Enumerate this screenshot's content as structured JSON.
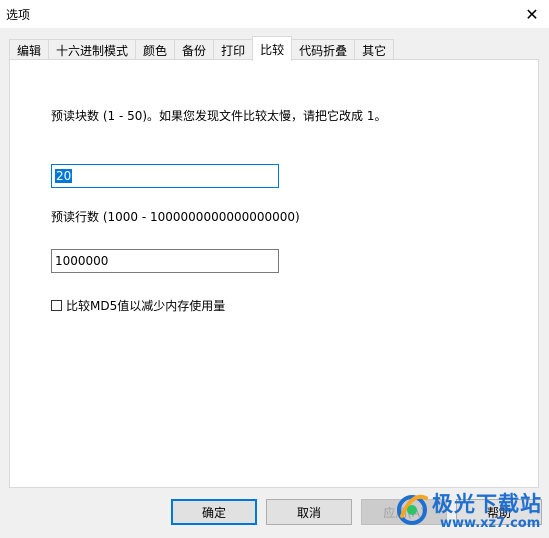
{
  "window": {
    "title": "选项"
  },
  "tabs": [
    {
      "label": "编辑"
    },
    {
      "label": "十六进制模式"
    },
    {
      "label": "颜色"
    },
    {
      "label": "备份"
    },
    {
      "label": "打印"
    },
    {
      "label": "比较",
      "active": true
    },
    {
      "label": "代码折叠"
    },
    {
      "label": "其它"
    }
  ],
  "compare": {
    "preread_blocks_label": "预读块数 (1 - 50)。如果您发现文件比较太慢，请把它改成 1。",
    "preread_blocks_value": "20",
    "preread_lines_label": "预读行数 (1000 - 1000000000000000000)",
    "preread_lines_value": "1000000",
    "md5_checkbox_label": "比较MD5值以减少内存使用量",
    "md5_checked": false
  },
  "buttons": {
    "ok": "确定",
    "cancel": "取消",
    "apply": "应用(A)",
    "help": "帮助"
  },
  "watermark": {
    "text": "极光下载站",
    "url": "www.xz7.com"
  },
  "colors": {
    "accent": "#0078d7",
    "watermark": "#1e6fd0"
  }
}
